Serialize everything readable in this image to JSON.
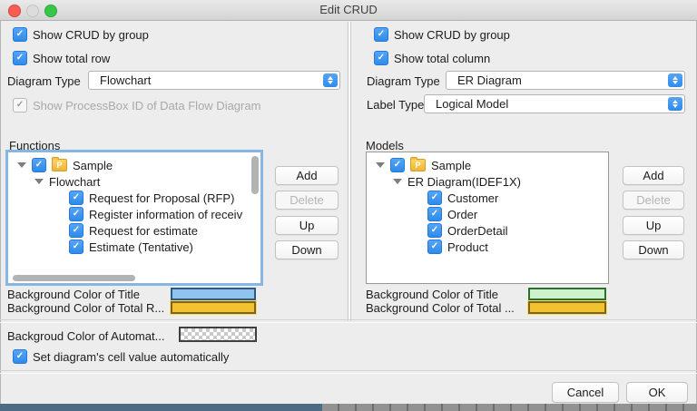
{
  "window": {
    "title": "Edit CRUD"
  },
  "icons": {
    "project_letter": "P"
  },
  "colors": {
    "traffic_red": "#f95d55",
    "traffic_gray": "#dcdcdc",
    "traffic_green": "#37c64a",
    "accent_blue": "#2f8bea",
    "accent_blue_light": "#55a5f6",
    "title_swatch_left": "#8fc4f1",
    "title_swatch_left_border": "#33587e",
    "total_swatch": "#f3c233",
    "total_swatch_border": "#7d6517",
    "title_swatch_right": "#cdf3cd",
    "title_swatch_right_border": "#2f6e33"
  },
  "left": {
    "show_crud_label": "Show CRUD by group",
    "show_total_label": "Show total row",
    "diagram_type_label": "Diagram Type",
    "diagram_type_value": "Flowchart",
    "processbox_label": "Show ProcessBox ID of Data Flow Diagram",
    "list_title": "Functions",
    "tree": [
      "Sample",
      "Flowchart",
      "Request for Proposal (RFP)",
      "Register information of receiv",
      "Request for estimate",
      "Estimate (Tentative)"
    ],
    "buttons": {
      "add": "Add",
      "delete": "Delete",
      "up": "Up",
      "down": "Down"
    },
    "bg_title_label": "Background Color of Title",
    "bg_total_label": "Background Color of Total R..."
  },
  "right": {
    "show_crud_label": "Show CRUD by group",
    "show_total_label": "Show total column",
    "diagram_type_label": "Diagram Type",
    "diagram_type_value": "ER Diagram",
    "label_type_label": "Label Type",
    "label_type_value": "Logical Model",
    "list_title": "Models",
    "tree": [
      "Sample",
      "ER Diagram(IDEF1X)",
      "Customer",
      "Order",
      "OrderDetail",
      "Product"
    ],
    "buttons": {
      "add": "Add",
      "delete": "Delete",
      "up": "Up",
      "down": "Down"
    },
    "bg_title_label": "Background Color of Title",
    "bg_total_label": "Background Color of Total ..."
  },
  "bottom": {
    "bg_automatic_label": "Backgroud Color of Automat...",
    "set_cell_value_label": "Set diagram's cell value automatically"
  },
  "footer": {
    "cancel": "Cancel",
    "ok": "OK"
  }
}
